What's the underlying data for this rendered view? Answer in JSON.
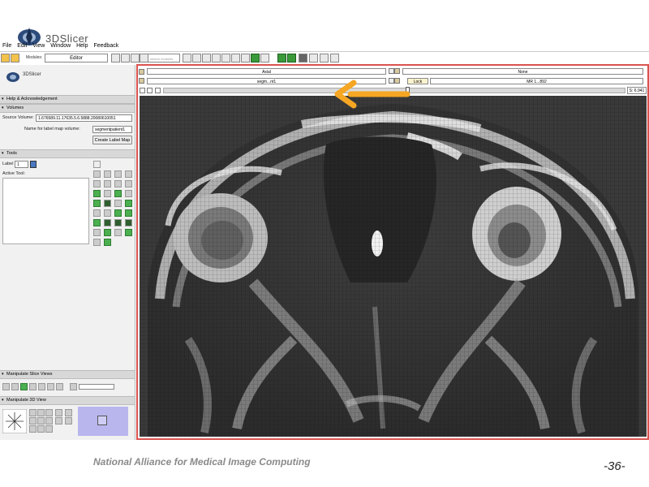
{
  "app": {
    "name": "3DSlicer"
  },
  "menu": [
    "File",
    "Edit",
    "View",
    "Window",
    "Help",
    "Feedback"
  ],
  "toolbar": {
    "modules_label": "Modules:",
    "module_selected": "Editor",
    "search_placeholder": "search modules"
  },
  "panel": {
    "logo_text": "3DSlicer",
    "sections": {
      "help": "Help & Acknowledgement",
      "volumes": "Volumes",
      "tools": "Tools",
      "slice_views": "Manipulate Slice Views",
      "view_3d": "Manipulate 3D View"
    },
    "volumes": {
      "source_label": "Source Volume:",
      "source_value": "1.676589.11.17635.5.6.5888.20080610051",
      "labelmap_label": "Name for label map volume:",
      "labelmap_value": "segmentpatient1",
      "create_button": "Create Label Map"
    },
    "tools": {
      "label_label": "Label",
      "label_value": "1",
      "active_tool_label": "Active Tool:"
    }
  },
  "viewer": {
    "orientation": "Axial",
    "foreground": "None",
    "label_volume": "segm...nt1",
    "background_volume": "MR 1...892",
    "lock_label": "Lock",
    "slice_readout": "S: 6.941"
  },
  "footer": {
    "organization": "National Alliance for Medical Image Computing",
    "page": "-36-"
  },
  "colors": {
    "viewer_border": "#d9534f",
    "arrow": "#f5a623",
    "label_swatch": "#4a78c2"
  }
}
